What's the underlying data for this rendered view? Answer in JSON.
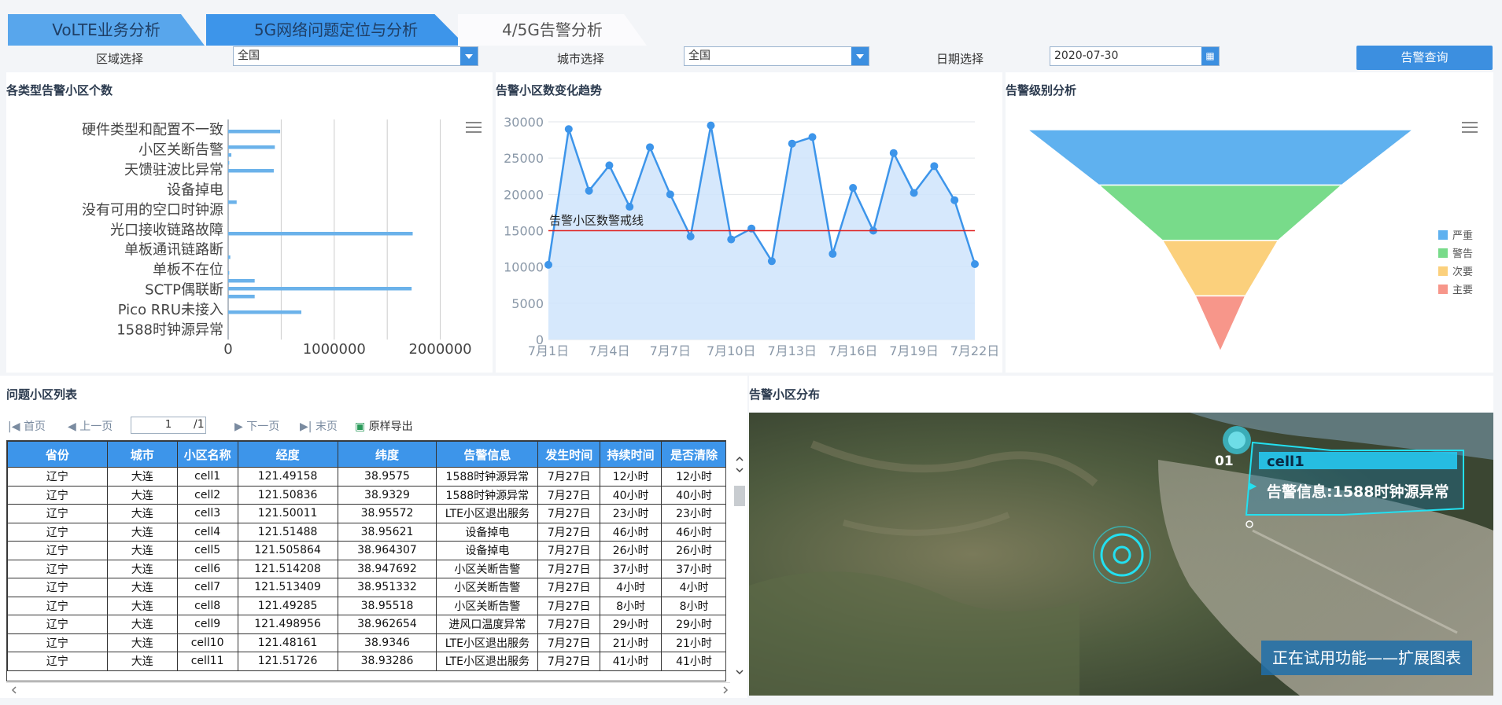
{
  "tabs": [
    {
      "label": "VoLTE业务分析"
    },
    {
      "label": "5G网络问题定位与分析"
    },
    {
      "label": "4/5G告警分析"
    }
  ],
  "filters": {
    "region_label": "区域选择",
    "region_value": "全国",
    "city_label": "城市选择",
    "city_value": "全国",
    "date_label": "日期选择",
    "date_value": "2020-07-30",
    "query_button": "告警查询"
  },
  "panels": {
    "bar_title": "各类型告警小区个数",
    "trend_title": "告警小区数变化趋势",
    "funnel_title": "告警级别分析",
    "list_title": "问题小区列表",
    "map_title": "告警小区分布"
  },
  "chart_data": [
    {
      "type": "bar",
      "orientation": "horizontal",
      "categories_shown": [
        "硬件类型和配置不一致",
        "小区关断告警",
        "天馈驻波比异常",
        "设备掉电",
        "没有可用的空口时钟源",
        "光口接收链路故障",
        "单板通讯链路断",
        "单板不在位",
        "SCTP偶联断",
        "Pico RRU未接入",
        "1588时钟源异常"
      ],
      "values": [
        0,
        490000,
        0,
        440000,
        30000,
        10000,
        430000,
        0,
        0,
        0,
        80000,
        0,
        0,
        0,
        1740000,
        0,
        0,
        20000,
        0,
        10000,
        250000,
        1730000,
        250000,
        0,
        690000,
        0,
        0,
        0
      ],
      "xticks": [
        "0",
        "1000000",
        "2000000"
      ],
      "xlim": [
        0,
        2300000
      ]
    },
    {
      "type": "area",
      "x": [
        "7月1日",
        "7月2日",
        "7月3日",
        "7月4日",
        "7月5日",
        "7月6日",
        "7月7日",
        "7月8日",
        "7月9日",
        "7月10日",
        "7月11日",
        "7月12日",
        "7月13日",
        "7月14日",
        "7月15日",
        "7月16日",
        "7月17日",
        "7月18日",
        "7月19日",
        "7月20日",
        "7月21日",
        "7月22日"
      ],
      "xticks": [
        "7月1日",
        "7月4日",
        "7月7日",
        "7月10日",
        "7月13日",
        "7月16日",
        "7月19日",
        "7月22日"
      ],
      "values": [
        10300,
        29000,
        20500,
        24000,
        18300,
        26500,
        20000,
        14200,
        29500,
        13800,
        15300,
        10800,
        27000,
        27900,
        11800,
        20900,
        15000,
        25700,
        20200,
        23900,
        19200,
        10400
      ],
      "yticks": [
        "0",
        "5000",
        "10000",
        "15000",
        "20000",
        "25000",
        "30000"
      ],
      "ylim": [
        0,
        30000
      ],
      "threshold": {
        "value": 15000,
        "label": "告警小区数警戒线",
        "color": "#e02020"
      },
      "color": "#3d95ea"
    },
    {
      "type": "funnel",
      "series": [
        {
          "name": "严重",
          "value": 100,
          "color": "#5fb1ef"
        },
        {
          "name": "警告",
          "value": 63,
          "color": "#78db8a"
        },
        {
          "name": "次要",
          "value": 30,
          "color": "#fbd07c"
        },
        {
          "name": "主要",
          "value": 13,
          "color": "#f7968a"
        }
      ],
      "legend_position": "right"
    }
  ],
  "pager": {
    "first": "首页",
    "prev": "上一页",
    "page_value": "1",
    "total": "/1",
    "next": "下一页",
    "last": "末页",
    "export": "原样导出"
  },
  "table": {
    "headers": [
      "省份",
      "城市",
      "小区名称",
      "经度",
      "纬度",
      "告警信息",
      "发生时间",
      "持续时间",
      "是否清除"
    ],
    "rows": [
      [
        "辽宁",
        "大连",
        "cell1",
        "121.49158",
        "38.9575",
        "1588时钟源异常",
        "7月27日",
        "12小时",
        "12小时"
      ],
      [
        "辽宁",
        "大连",
        "cell2",
        "121.50836",
        "38.9329",
        "1588时钟源异常",
        "7月27日",
        "40小时",
        "40小时"
      ],
      [
        "辽宁",
        "大连",
        "cell3",
        "121.50011",
        "38.95572",
        "LTE小区退出服务",
        "7月27日",
        "23小时",
        "23小时"
      ],
      [
        "辽宁",
        "大连",
        "cell4",
        "121.51488",
        "38.95621",
        "设备掉电",
        "7月27日",
        "46小时",
        "46小时"
      ],
      [
        "辽宁",
        "大连",
        "cell5",
        "121.505864",
        "38.964307",
        "设备掉电",
        "7月27日",
        "26小时",
        "26小时"
      ],
      [
        "辽宁",
        "大连",
        "cell6",
        "121.514208",
        "38.947692",
        "小区关断告警",
        "7月27日",
        "37小时",
        "37小时"
      ],
      [
        "辽宁",
        "大连",
        "cell7",
        "121.513409",
        "38.951332",
        "小区关断告警",
        "7月27日",
        "4小时",
        "4小时"
      ],
      [
        "辽宁",
        "大连",
        "cell8",
        "121.49285",
        "38.95518",
        "小区关断告警",
        "7月27日",
        "8小时",
        "8小时"
      ],
      [
        "辽宁",
        "大连",
        "cell9",
        "121.498956",
        "38.962654",
        "进风口温度异常",
        "7月27日",
        "29小时",
        "29小时"
      ],
      [
        "辽宁",
        "大连",
        "cell10",
        "121.48161",
        "38.9346",
        "LTE小区退出服务",
        "7月27日",
        "21小时",
        "21小时"
      ],
      [
        "辽宁",
        "大连",
        "cell11",
        "121.51726",
        "38.93286",
        "LTE小区退出服务",
        "7月27日",
        "41小时",
        "41小时"
      ]
    ]
  },
  "map": {
    "marker_index": "01",
    "cell_name": "cell1",
    "alert_info": "告警信息:1588时钟源异常",
    "trial_label": "正在试用功能——扩展图表"
  }
}
